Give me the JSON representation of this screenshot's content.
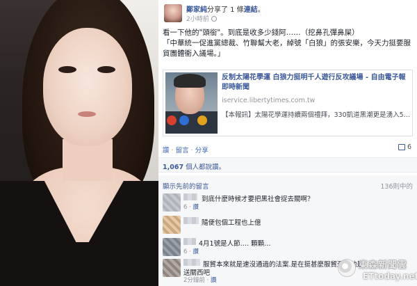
{
  "post": {
    "author": "鄭家純",
    "verb": "分享了 1 條",
    "link_word": "連結",
    "time": "2小時前",
    "status_line1": "看一下他的\"頭銜\"。到底是收多少錢阿……（挖鼻孔彈鼻屎）",
    "status_line2": "「中華統一促進黨總裁、竹聯幫大老，綽號「白狼」的張安樂，今天力挺要服貿團體衝入議場。」"
  },
  "share_card": {
    "title": "反制太陽花學運 白狼力挺明千人遊行反攻議場 - 自由電子報 即時新聞",
    "domain": "iservice.libertytimes.com.tw",
    "description": "【本報訊】太陽花學運持續兩個禮拜，330凱道黑潮更是湧入5…"
  },
  "actions": {
    "like": "讚",
    "comment": "留言",
    "share": "分享",
    "share_count": "6"
  },
  "likes": {
    "count": "1,067",
    "suffix": " 個人都說讚。"
  },
  "comments_header": {
    "more": "顯示先前的留言",
    "count": "136則中的"
  },
  "comments": [
    {
      "text": "到底什麼時候才要把黑社會捉去關啊？",
      "meta": "6",
      "like": "讚"
    },
    {
      "text": "隨便包個工程也上億",
      "meta": "",
      "like": ""
    },
    {
      "text": "4月1號是人節…. 顆顆…",
      "meta": "6",
      "like": "讚"
    },
    {
      "text": "服貿本來就是速沒通過的法案.是在挺甚麼服貿還有他是",
      "meta": "",
      "like": ""
    },
    {
      "text": "送關西吧",
      "meta": "2分鐘前",
      "like": "讚"
    }
  ],
  "watermark": {
    "cn": "東森新聞雲",
    "en": "ETtoday.net"
  }
}
